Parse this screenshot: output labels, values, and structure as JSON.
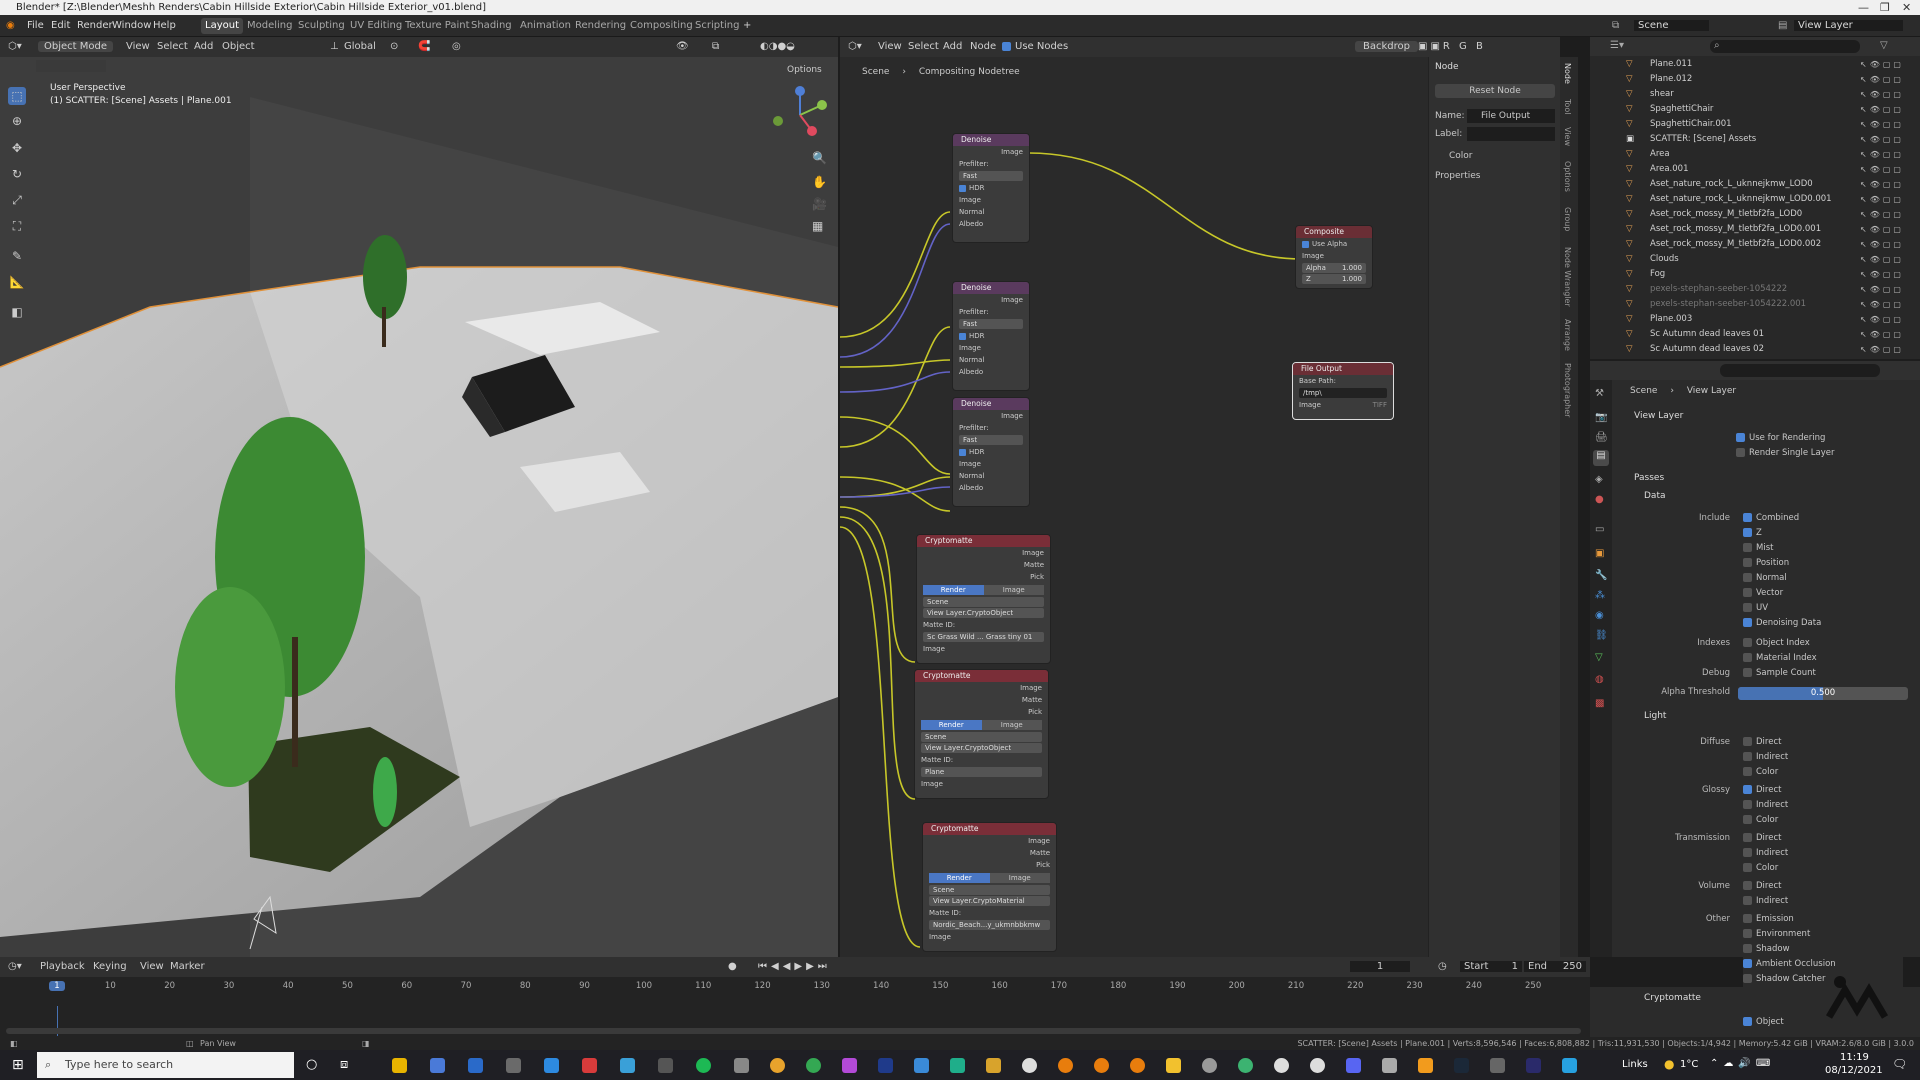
{
  "titlebar": {
    "title": "Blender* [Z:\\Blender\\Meshh Renders\\Cabin Hillside Exterior\\Cabin Hillside Exterior_v01.blend]"
  },
  "menus": [
    "File",
    "Edit",
    "Render",
    "Window",
    "Help"
  ],
  "workspaces": [
    "Layout",
    "Modeling",
    "Sculpting",
    "UV Editing",
    "Texture Paint",
    "Shading",
    "Animation",
    "Rendering",
    "Compositing",
    "Scripting"
  ],
  "topright": {
    "scene": "Scene",
    "view_layer": "View Layer"
  },
  "viewport": {
    "mode": "Object Mode",
    "menus": [
      "View",
      "Select",
      "Add",
      "Object"
    ],
    "orientation": "Global",
    "options": "Options",
    "overlay_title": "User Perspective",
    "overlay_sub": "(1) SCATTER: [Scene] Assets | Plane.001"
  },
  "node_editor": {
    "menus": [
      "View",
      "Select",
      "Add",
      "Node"
    ],
    "use_nodes": "Use Nodes",
    "backdrop": "Backdrop",
    "breadcrumb": [
      "Scene",
      "Compositing Nodetree"
    ],
    "nodes": {
      "denoise": {
        "title": "Denoise",
        "image": "Image",
        "prefilter": "Prefilter:",
        "fast": "Fast",
        "hdr": "HDR",
        "normal": "Normal",
        "albedo": "Albedo"
      },
      "composite": {
        "title": "Composite",
        "use_alpha": "Use Alpha",
        "image": "Image",
        "alpha": "Alpha",
        "alpha_val": "1.000",
        "z": "Z",
        "z_val": "1.000"
      },
      "file_output": {
        "title": "File Output",
        "base_path": "Base Path:",
        "path": "/tmp\\",
        "image": "Image",
        "tiff": "TIFF"
      },
      "crypto": {
        "title": "Cryptomatte",
        "image": "Image",
        "matte": "Matte",
        "pick": "Pick",
        "render": "Render",
        "image_tab": "Image",
        "scene": "Scene",
        "matte_id": "Matte ID:",
        "layer_obj": "View Layer.CryptoObject",
        "layer_mat": "View Layer.CryptoMaterial"
      },
      "crypto_ids": [
        "Sc Grass Wild ... Grass tiny 01",
        "Plane",
        "Nordic_Beach...y_ukmnbbkmw"
      ],
      "crypto_titles": [
        "Cryptomatte",
        "Cryptomatte",
        "Cryptomatte"
      ]
    }
  },
  "npanel": {
    "header": "Node",
    "reset": "Reset Node",
    "name_label": "Name:",
    "name_value": "File Output",
    "label_label": "Label:",
    "color": "Color",
    "properties": "Properties",
    "tabs": [
      "Node",
      "Tool",
      "View",
      "Options",
      "Group",
      "Node Wrangler",
      "Arrange",
      "Photographer"
    ]
  },
  "outliner": {
    "rows": [
      {
        "name": "Plane.011",
        "dim": false
      },
      {
        "name": "Plane.012",
        "dim": false
      },
      {
        "name": "shear",
        "dim": false
      },
      {
        "name": "SpaghettiChair",
        "dim": false
      },
      {
        "name": "SpaghettiChair.001",
        "dim": false
      },
      {
        "name": "SCATTER: [Scene] Assets",
        "dim": false
      },
      {
        "name": "Area",
        "dim": false
      },
      {
        "name": "Area.001",
        "dim": false
      },
      {
        "name": "Aset_nature_rock_L_uknnejkmw_LOD0",
        "dim": false
      },
      {
        "name": "Aset_nature_rock_L_uknnejkmw_LOD0.001",
        "dim": false
      },
      {
        "name": "Aset_rock_mossy_M_tletbf2fa_LOD0",
        "dim": false
      },
      {
        "name": "Aset_rock_mossy_M_tletbf2fa_LOD0.001",
        "dim": false
      },
      {
        "name": "Aset_rock_mossy_M_tletbf2fa_LOD0.002",
        "dim": false
      },
      {
        "name": "Clouds",
        "dim": false
      },
      {
        "name": "Fog",
        "dim": false
      },
      {
        "name": "pexels-stephan-seeber-1054222",
        "dim": true
      },
      {
        "name": "pexels-stephan-seeber-1054222.001",
        "dim": true
      },
      {
        "name": "Plane.003",
        "dim": false
      },
      {
        "name": "Sc Autumn dead leaves 01",
        "dim": false
      },
      {
        "name": "Sc Autumn dead leaves 02",
        "dim": false
      }
    ]
  },
  "properties": {
    "breadcrumb": [
      "Scene",
      "View Layer"
    ],
    "view_layer": "View Layer",
    "use_for_rendering": "Use for Rendering",
    "render_single_layer": "Render Single Layer",
    "passes": "Passes",
    "data": "Data",
    "include": "Include",
    "data_items": [
      {
        "label": "Combined",
        "on": true
      },
      {
        "label": "Z",
        "on": true
      },
      {
        "label": "Mist",
        "on": false
      },
      {
        "label": "Position",
        "on": false
      },
      {
        "label": "Normal",
        "on": false
      },
      {
        "label": "Vector",
        "on": false
      },
      {
        "label": "UV",
        "on": false
      },
      {
        "label": "Denoising Data",
        "on": true
      }
    ],
    "indexes": "Indexes",
    "object_index": "Object Index",
    "material_index": "Material Index",
    "debug": "Debug",
    "sample_count": "Sample Count",
    "alpha_threshold": "Alpha Threshold",
    "alpha_value": "0.500",
    "light": "Light",
    "diffuse": "Diffuse",
    "glossy": "Glossy",
    "transmission": "Transmission",
    "volume": "Volume",
    "other": "Other",
    "direct": "Direct",
    "indirect": "Indirect",
    "color": "Color",
    "emission": "Emission",
    "environment": "Environment",
    "shadow": "Shadow",
    "ambient_occlusion": "Ambient Occlusion",
    "shadow_catcher": "Shadow Catcher",
    "cryptomatte": "Cryptomatte",
    "object": "Object"
  },
  "timeline": {
    "menus": [
      "Playback",
      "Keying",
      "View",
      "Marker"
    ],
    "current": "1",
    "start_label": "Start",
    "start": "1",
    "end_label": "End",
    "end": "250",
    "ticks": [
      "1",
      "10",
      "20",
      "30",
      "40",
      "50",
      "60",
      "70",
      "80",
      "90",
      "100",
      "110",
      "120",
      "130",
      "140",
      "150",
      "160",
      "170",
      "180",
      "190",
      "200",
      "210",
      "220",
      "230",
      "240",
      "250"
    ]
  },
  "statusbar": {
    "left": "Pan View",
    "right": "SCATTER: [Scene] Assets | Plane.001 | Verts:8,596,546 | Faces:6,808,882 | Tris:11,931,530 | Objects:1/4,942 | Memory:5.42 GiB | VRAM:2.6/8.0 GiB | 3.0.0"
  },
  "taskbar": {
    "search": "Type here to search",
    "links": "Links",
    "temp": "1°C",
    "time": "11:19",
    "date": "08/12/2021"
  }
}
